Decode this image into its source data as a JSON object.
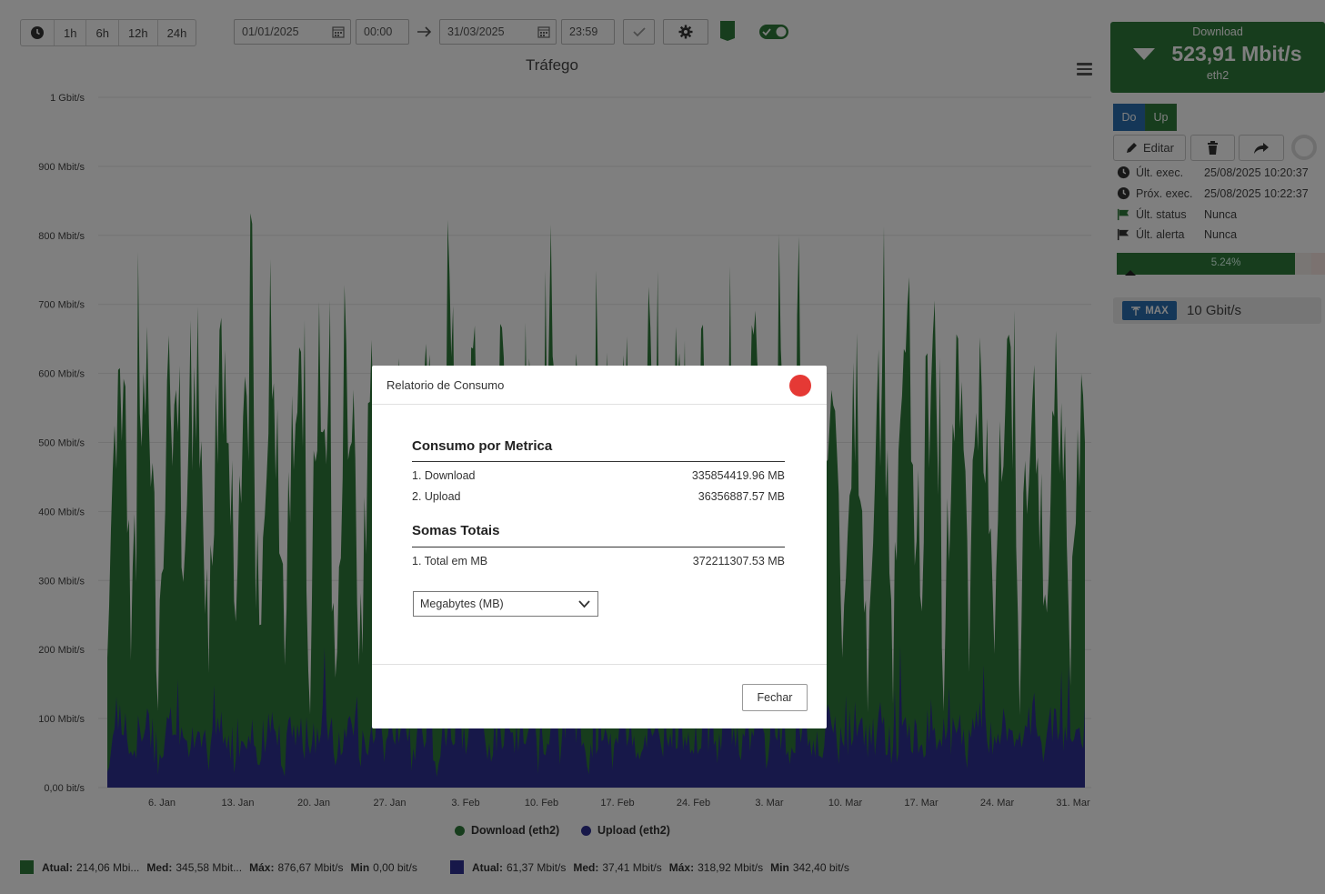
{
  "toolbar": {
    "ranges": [
      "1h",
      "6h",
      "12h",
      "24h"
    ],
    "start_date": "01/01/2025",
    "start_time": "00:00",
    "end_date": "31/03/2025",
    "end_time": "23:59"
  },
  "chart_data": {
    "type": "area",
    "title": "Tráfego",
    "y_ticks": [
      "0,00 bit/s",
      "100 Mbit/s",
      "200 Mbit/s",
      "300 Mbit/s",
      "400 Mbit/s",
      "500 Mbit/s",
      "600 Mbit/s",
      "700 Mbit/s",
      "800 Mbit/s",
      "900 Mbit/s",
      "1 Gbit/s"
    ],
    "x_ticks": [
      "6. Jan",
      "13. Jan",
      "20. Jan",
      "27. Jan",
      "3. Feb",
      "10. Feb",
      "17. Feb",
      "24. Feb",
      "3. Mar",
      "10. Mar",
      "17. Mar",
      "24. Mar",
      "31. Mar"
    ],
    "ylim": [
      0,
      1000
    ],
    "series": [
      {
        "name": "Download (eth2)",
        "color": "#2f7a3a",
        "min": 0,
        "avg": 345.58,
        "max": 876.67
      },
      {
        "name": "Upload (eth2)",
        "color": "#2e3192",
        "min": 0.0003424,
        "avg": 37.41,
        "max": 318.92
      }
    ]
  },
  "legend": {
    "download": "Download (eth2)",
    "upload": "Upload (eth2)"
  },
  "stats": {
    "download": {
      "atual_label": "Atual:",
      "atual": "214,06 Mbi...",
      "med_label": "Med:",
      "med": "345,58 Mbit...",
      "max_label": "Máx:",
      "max": "876,67 Mbit/s",
      "min_label": "Min",
      "min": "0,00 bit/s"
    },
    "upload": {
      "atual_label": "Atual:",
      "atual": "61,37 Mbit/s",
      "med_label": "Med:",
      "med": "37,41 Mbit/s",
      "max_label": "Máx:",
      "max": "318,92 Mbit/s",
      "min_label": "Min",
      "min": "342,40 bit/s"
    }
  },
  "panel": {
    "card_label": "Download",
    "card_value": "523,91 Mbit/s",
    "card_iface": "eth2",
    "toggle_do": "Do",
    "toggle_up": "Up",
    "edit_label": "Editar",
    "info": [
      {
        "key": "Últ. exec.",
        "value": "25/08/2025 10:20:37"
      },
      {
        "key": "Próx. exec.",
        "value": "25/08/2025 10:22:37"
      },
      {
        "key": "Últ. status",
        "value": "Nunca"
      },
      {
        "key": "Últ. alerta",
        "value": "Nunca"
      }
    ],
    "progress_text": "5.24%",
    "progress_value": 0.0524,
    "max_badge": "MAX",
    "max_value": "10 Gbit/s"
  },
  "modal": {
    "title": "Relatorio de Consumo",
    "section1": "Consumo por Metrica",
    "rows1": [
      {
        "label": "1. Download",
        "value": "335854419.96 MB"
      },
      {
        "label": "2. Upload",
        "value": "36356887.57 MB"
      }
    ],
    "section2": "Somas Totais",
    "rows2": [
      {
        "label": "1. Total em MB",
        "value": "372211307.53 MB"
      }
    ],
    "unit_select": "Megabytes (MB)",
    "close_button": "Fechar"
  }
}
